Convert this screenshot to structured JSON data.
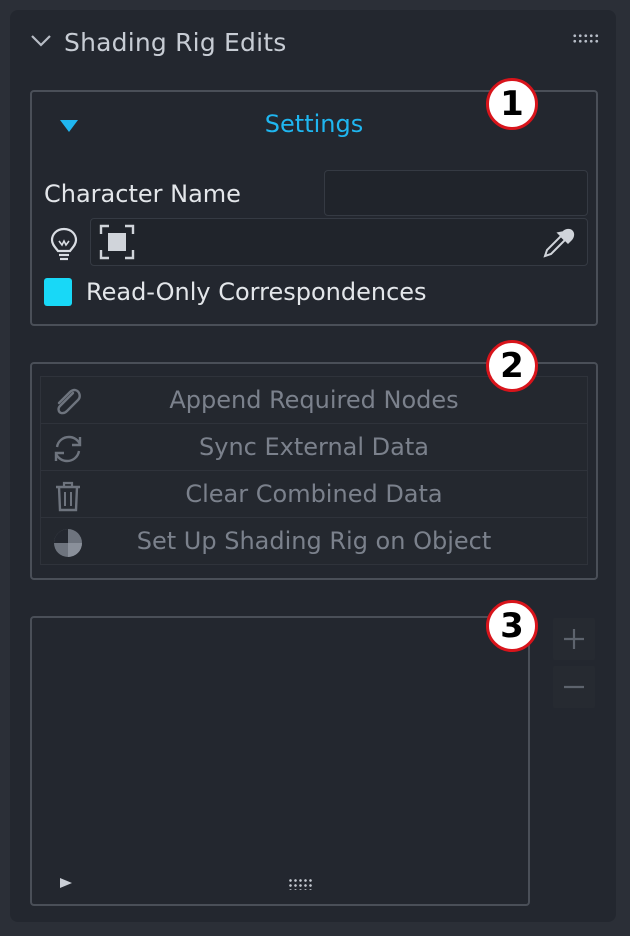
{
  "panel": {
    "title": "Shading Rig Edits"
  },
  "settings": {
    "title": "Settings",
    "character_name_label": "Character Name",
    "character_name_value": "",
    "object_field_value": "",
    "readonly_label": "Read-Only Correspondences",
    "readonly_checked": true
  },
  "actions": [
    {
      "label": "Append Required Nodes",
      "icon": "paperclip-icon"
    },
    {
      "label": "Sync External Data",
      "icon": "sync-icon"
    },
    {
      "label": "Clear Combined Data",
      "icon": "trash-icon"
    },
    {
      "label": "Set Up Shading Rig on Object",
      "icon": "shading-sphere-icon"
    }
  ],
  "badges": [
    "1",
    "2",
    "3"
  ],
  "colors": {
    "accent": "#1fb6f0",
    "checkbox": "#18d8f7",
    "badge_ring": "#d8141b"
  }
}
